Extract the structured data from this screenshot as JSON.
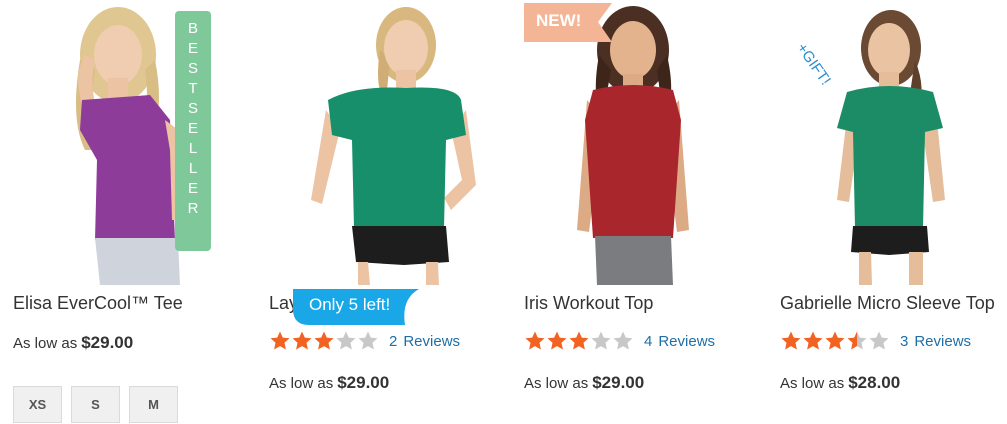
{
  "colors": {
    "star_filled": "#f26322",
    "star_empty": "#c8c8c8",
    "reviews_link": "#1e6fa8",
    "bestseller_badge": "#7ec89a",
    "new_badge": "#f4b496",
    "only_left_badge": "#1aa7e8",
    "gift_text": "#2c8ed1"
  },
  "products": [
    {
      "name": "Elisa EverCool™ Tee",
      "price_prefix": "As low as",
      "price": "$29.00",
      "badge": "BESTSELLER",
      "shirt_color": "#8e3c99",
      "sizes": [
        "XS",
        "S",
        "M"
      ]
    },
    {
      "name": "Layla Tee",
      "price_prefix": "As low as",
      "price": "$29.00",
      "badge": "Only 5 left!",
      "rating": 3,
      "review_count": "2",
      "review_label": "Reviews",
      "shirt_color": "#178f6b"
    },
    {
      "name": "Iris Workout Top",
      "price_prefix": "As low as",
      "price": "$29.00",
      "badge": "NEW!",
      "rating": 3,
      "review_count": "4",
      "review_label": "Reviews",
      "shirt_color": "#a8262c"
    },
    {
      "name": "Gabrielle Micro Sleeve Top",
      "price_prefix": "As low as",
      "price": "$28.00",
      "badge": "+GIFT!",
      "rating": 3.5,
      "review_count": "3",
      "review_label": "Reviews",
      "shirt_color": "#1c8c66"
    }
  ]
}
